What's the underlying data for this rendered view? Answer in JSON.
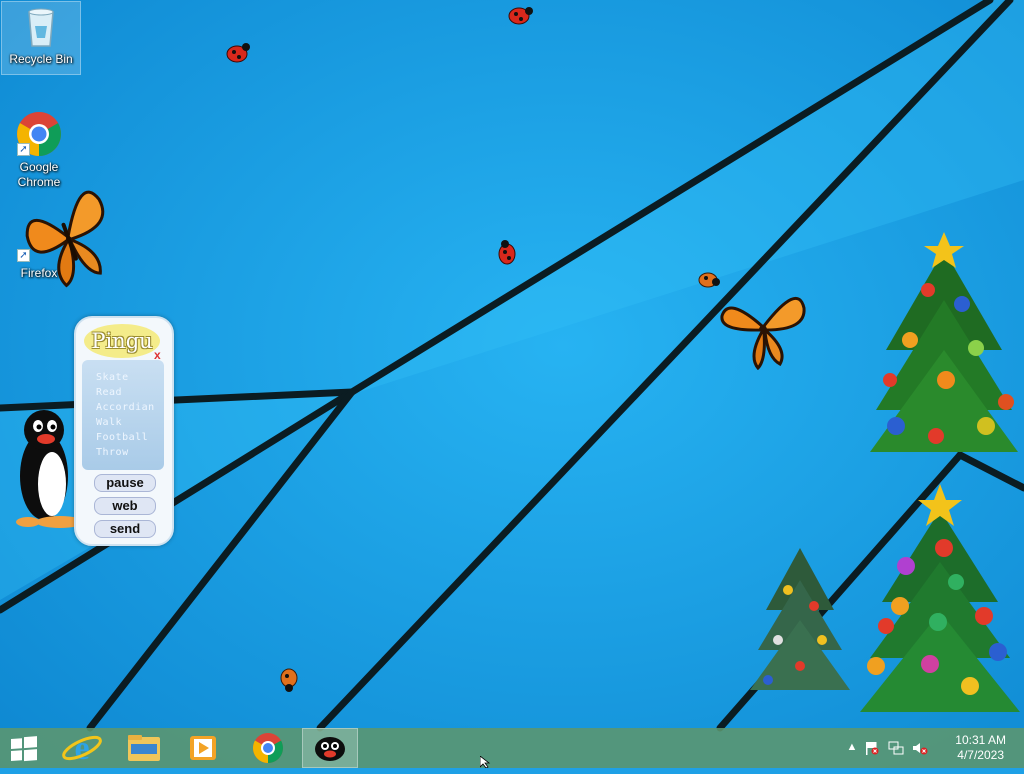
{
  "desktop": {
    "icons": [
      {
        "label": "Recycle Bin"
      },
      {
        "label": "Google\nChrome"
      },
      {
        "label": "Firefox"
      }
    ]
  },
  "pingu_widget": {
    "title": "Pingu",
    "close": "x",
    "menu_items": [
      "Skate",
      "Read",
      "Accordian",
      "Walk",
      "Football",
      "Throw"
    ],
    "buttons": {
      "pause": "pause",
      "web": "web",
      "send": "send"
    }
  },
  "taskbar": {
    "pinned": [
      "start-button",
      "internet-explorer",
      "file-explorer",
      "media-player",
      "google-chrome",
      "pingu"
    ],
    "active_app": "pingu"
  },
  "tray": {
    "time": "10:31 AM",
    "date": "4/7/2023"
  },
  "colors": {
    "wallpaper": "#1ea0e6",
    "taskbar": "#5c966e"
  }
}
